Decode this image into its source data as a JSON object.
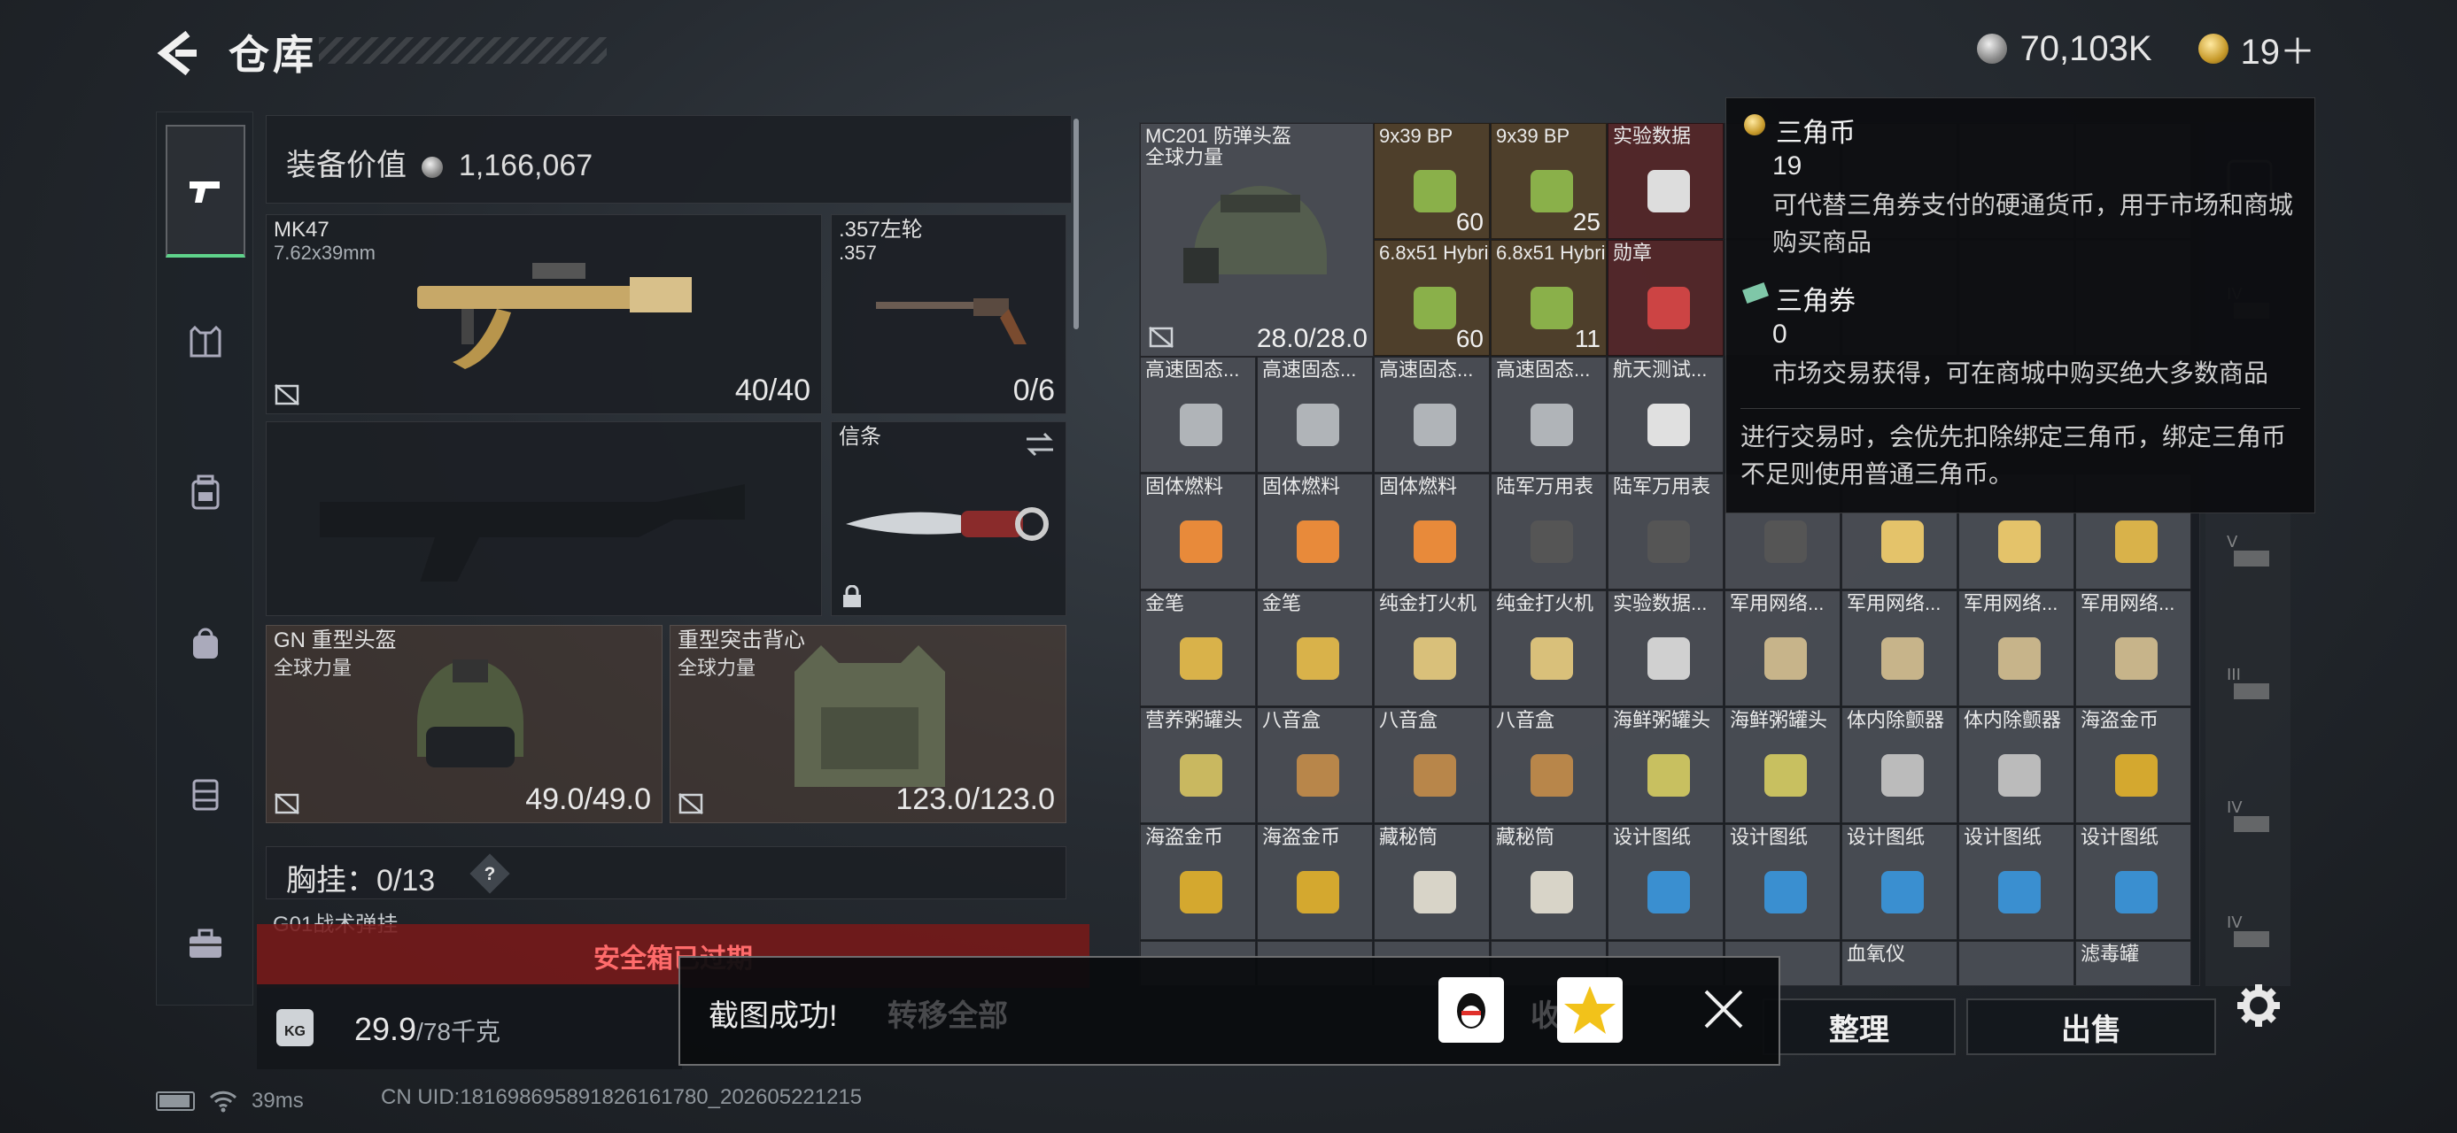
{
  "header": {
    "title": "仓库",
    "currency": [
      {
        "icon": "silver-coin-icon",
        "value": "70,103K"
      },
      {
        "icon": "gold-triangle-coin-icon",
        "value": "19＋"
      }
    ]
  },
  "nav": {
    "items": [
      {
        "name": "weapons",
        "icon": "pistol-icon",
        "active": true
      },
      {
        "name": "armor",
        "icon": "vest-icon",
        "active": false
      },
      {
        "name": "backpack",
        "icon": "backpack-icon",
        "active": false
      },
      {
        "name": "bag",
        "icon": "bag-icon",
        "active": false
      },
      {
        "name": "case",
        "icon": "case-icon",
        "active": false
      },
      {
        "name": "toolbox",
        "icon": "toolbox-icon",
        "active": false
      }
    ]
  },
  "loadout": {
    "equip_value_label": "装备价值",
    "equip_value": "1,166,067",
    "primary": {
      "name": "MK47",
      "caliber": "7.62x39mm",
      "ammo": "40/40"
    },
    "sidearm": {
      "name": ".357左轮",
      "caliber": ".357",
      "ammo": "0/6"
    },
    "melee": {
      "name": "信条"
    },
    "helmet": {
      "name": "GN 重型头盔",
      "brand": "全球力量",
      "durability": "49.0/49.0"
    },
    "armor": {
      "name": "重型突击背心",
      "brand": "全球力量",
      "durability": "123.0/123.0"
    },
    "chest_rig": {
      "label": "胸挂：",
      "value": "0/13",
      "help": "?"
    },
    "chest_sub": "G01战术弹挂",
    "safe_box": "安全箱已过期",
    "weight": {
      "value": "29.9",
      "max": "/78千克",
      "badge": "KG"
    },
    "transfer_all": "转移全部"
  },
  "stash": {
    "helmet": {
      "name": "MC201 防弹头盔",
      "brand": "全球力量",
      "durability": "28.0/28.0"
    },
    "rows": [
      [
        {
          "name": "9x39 BP",
          "count": "60",
          "tone": "gold",
          "icon": "ammo-box-icon"
        },
        {
          "name": "9x39 BP",
          "count": "25",
          "tone": "gold",
          "icon": "ammo-box-icon"
        },
        {
          "name": "实验数据",
          "count": "",
          "tone": "red",
          "icon": "disc-icon"
        }
      ],
      [
        {
          "name": "6.8x51 Hybrid",
          "count": "60",
          "tone": "gold",
          "icon": "ammo-box-icon"
        },
        {
          "name": "6.8x51 Hybrid",
          "count": "11",
          "tone": "gold",
          "icon": "ammo-box-icon"
        },
        {
          "name": "勋章",
          "count": "",
          "tone": "red",
          "icon": "medal-icon"
        }
      ]
    ],
    "grid": [
      [
        {
          "name": "高速固态...",
          "icon": "ssd-icon",
          "tone": "grey"
        },
        {
          "name": "高速固态...",
          "icon": "ssd-icon",
          "tone": "grey"
        },
        {
          "name": "高速固态...",
          "icon": "ssd-icon",
          "tone": "grey"
        },
        {
          "name": "高速固态...",
          "icon": "ssd-icon",
          "tone": "grey"
        },
        {
          "name": "航天测试...",
          "icon": "drive-icon",
          "tone": "grey"
        }
      ],
      [
        {
          "name": "固体燃料",
          "icon": "fuel-icon",
          "tone": "grey"
        },
        {
          "name": "固体燃料",
          "icon": "fuel-icon",
          "tone": "grey"
        },
        {
          "name": "固体燃料",
          "icon": "fuel-icon",
          "tone": "grey"
        },
        {
          "name": "陆军万用表",
          "icon": "multimeter-icon",
          "tone": "grey"
        },
        {
          "name": "陆军万用表",
          "icon": "multimeter-icon",
          "tone": "grey"
        },
        {
          "name": "",
          "icon": "multimeter-icon",
          "tone": "grey"
        },
        {
          "name": "",
          "icon": "cup-icon",
          "tone": "grey"
        },
        {
          "name": "",
          "icon": "cup-icon",
          "tone": "grey"
        },
        {
          "name": "",
          "icon": "pen-icon",
          "tone": "grey"
        }
      ],
      [
        {
          "name": "金笔",
          "icon": "pen-icon",
          "tone": "grey"
        },
        {
          "name": "金笔",
          "icon": "pen-icon",
          "tone": "grey"
        },
        {
          "name": "纯金打火机",
          "icon": "lighter-icon",
          "tone": "grey"
        },
        {
          "name": "纯金打火机",
          "icon": "lighter-icon",
          "tone": "grey"
        },
        {
          "name": "实验数据...",
          "icon": "usb-icon",
          "tone": "grey"
        },
        {
          "name": "军用网络...",
          "icon": "network-icon",
          "tone": "grey"
        },
        {
          "name": "军用网络...",
          "icon": "network-icon",
          "tone": "grey"
        },
        {
          "name": "军用网络...",
          "icon": "network-icon",
          "tone": "grey"
        },
        {
          "name": "军用网络...",
          "icon": "network-icon",
          "tone": "grey"
        }
      ],
      [
        {
          "name": "营养粥罐头",
          "icon": "can-icon",
          "tone": "grey"
        },
        {
          "name": "八音盒",
          "icon": "music-box-icon",
          "tone": "grey"
        },
        {
          "name": "八音盒",
          "icon": "music-box-icon",
          "tone": "grey"
        },
        {
          "name": "八音盒",
          "icon": "music-box-icon",
          "tone": "grey"
        },
        {
          "name": "海鲜粥罐头",
          "icon": "tin-icon",
          "tone": "grey"
        },
        {
          "name": "海鲜粥罐头",
          "icon": "tin-icon",
          "tone": "grey"
        },
        {
          "name": "体内除颤器",
          "icon": "defib-icon",
          "tone": "grey"
        },
        {
          "name": "体内除颤器",
          "icon": "defib-icon",
          "tone": "grey"
        },
        {
          "name": "海盗金币",
          "icon": "gold-coin-icon",
          "tone": "grey"
        }
      ],
      [
        {
          "name": "海盗金币",
          "icon": "gold-coin-icon",
          "tone": "grey"
        },
        {
          "name": "海盗金币",
          "icon": "gold-coin-icon",
          "tone": "grey"
        },
        {
          "name": "藏秘筒",
          "icon": "cylinder-icon",
          "tone": "grey"
        },
        {
          "name": "藏秘筒",
          "icon": "cylinder-icon",
          "tone": "grey"
        },
        {
          "name": "设计图纸",
          "icon": "blueprint-icon",
          "tone": "grey"
        },
        {
          "name": "设计图纸",
          "icon": "blueprint-icon",
          "tone": "grey"
        },
        {
          "name": "设计图纸",
          "icon": "blueprint-icon",
          "tone": "grey"
        },
        {
          "name": "设计图纸",
          "icon": "blueprint-icon",
          "tone": "grey"
        },
        {
          "name": "设计图纸",
          "icon": "blueprint-icon",
          "tone": "grey"
        }
      ],
      [
        {
          "name": "",
          "icon": "",
          "tone": "grey"
        },
        {
          "name": "",
          "icon": "",
          "tone": "grey"
        },
        {
          "name": "",
          "icon": "",
          "tone": "grey"
        },
        {
          "name": "",
          "icon": "",
          "tone": "grey"
        },
        {
          "name": "",
          "icon": "",
          "tone": "grey"
        },
        {
          "name": "",
          "icon": "",
          "tone": "grey"
        },
        {
          "name": "血氧仪",
          "icon": "",
          "tone": "grey"
        },
        {
          "name": "",
          "icon": "",
          "tone": "grey"
        },
        {
          "name": "滤毒罐",
          "icon": "",
          "tone": "grey"
        }
      ]
    ]
  },
  "tooltip": {
    "coin_title": "三角币",
    "coin_value": "19",
    "coin_desc": "可代替三角券支付的硬通货币，用于市场和商城购买商品",
    "ticket_title": "三角券",
    "ticket_value": "0",
    "ticket_desc": "市场交易获得，可在商城中购买绝大多数商品",
    "note": "进行交易时，会优先扣除绑定三角币，绑定三角币不足则使用普通三角币。"
  },
  "actions": {
    "organize": "整理",
    "sell": "出售",
    "collect_ghost": "收藏室"
  },
  "toast": {
    "message": "截图成功!"
  },
  "status": {
    "ping": "39ms",
    "uid": "CN UID:181698695891826161780_202605221215"
  },
  "colors": {
    "accent_green": "#5fd38b",
    "safe_box_red": "#ff6b6b"
  }
}
